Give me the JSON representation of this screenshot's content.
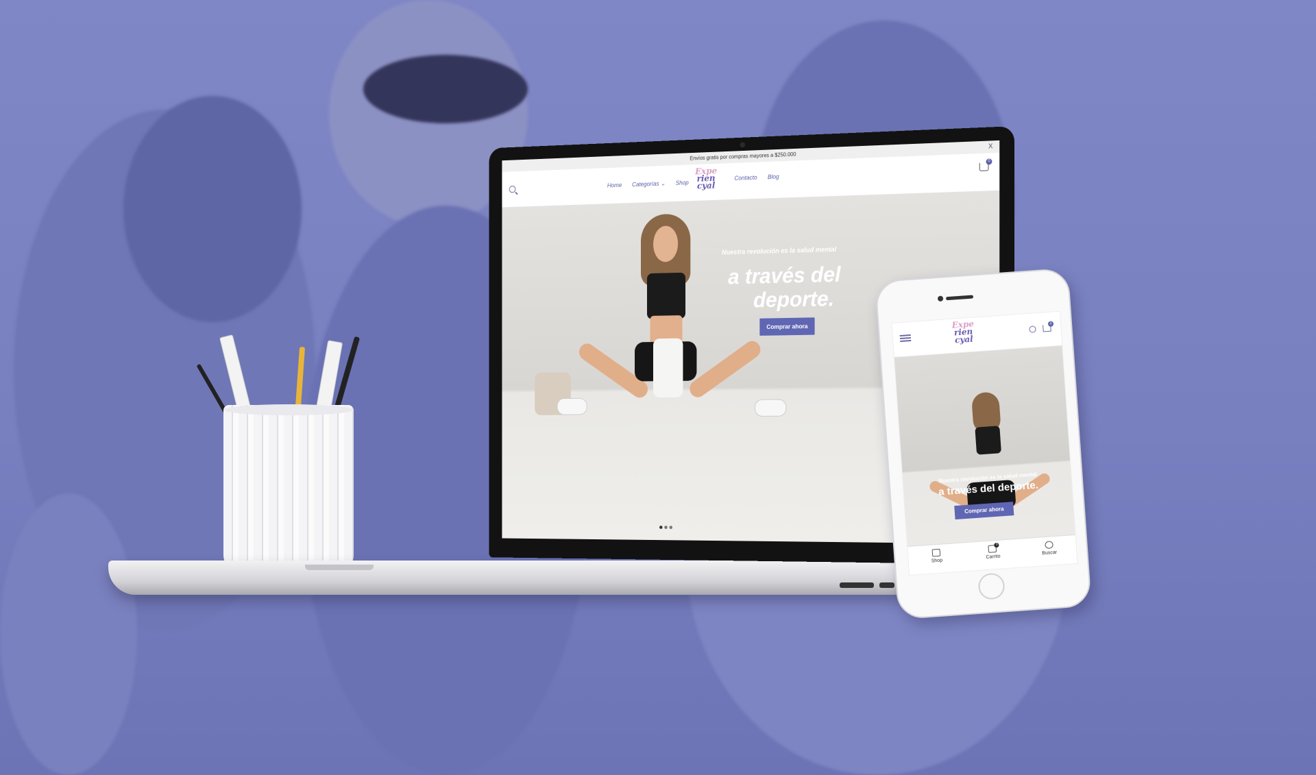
{
  "site": {
    "announcement": "Envíos gratis por compras mayores a $250.000",
    "close_label": "X",
    "nav_left": [
      "Home",
      "Categorías ⌄",
      "Shop"
    ],
    "nav_right": [
      "Contacto",
      "Blog"
    ],
    "logo_lines": [
      "Expe",
      "rien",
      "cyal"
    ],
    "cart_count": "0",
    "hero_subtitle": "Nuestra revolución es la salud mental",
    "hero_title_line1": "a través del",
    "hero_title_line2": "deporte.",
    "hero_cta": "Comprar ahora",
    "slides": 3,
    "active_slide": 1
  },
  "mobile": {
    "logo_lines": [
      "Expe",
      "rien",
      "cyal"
    ],
    "cart_count": "0",
    "hero_subtitle": "Nuestra revolución es la salud mental",
    "hero_title": "a través del deporte.",
    "hero_cta": "Comprar ahora",
    "tabs": [
      {
        "label": "Shop",
        "icon": "grid-icon"
      },
      {
        "label": "Carrito",
        "icon": "cart-icon",
        "badge": "0"
      },
      {
        "label": "Buscar",
        "icon": "search-icon"
      }
    ]
  },
  "colors": {
    "background": "#7b83c2",
    "accent": "#5f66b3",
    "logo_pink": "#d9a0c6",
    "logo_purple": "#6a5bb0"
  }
}
